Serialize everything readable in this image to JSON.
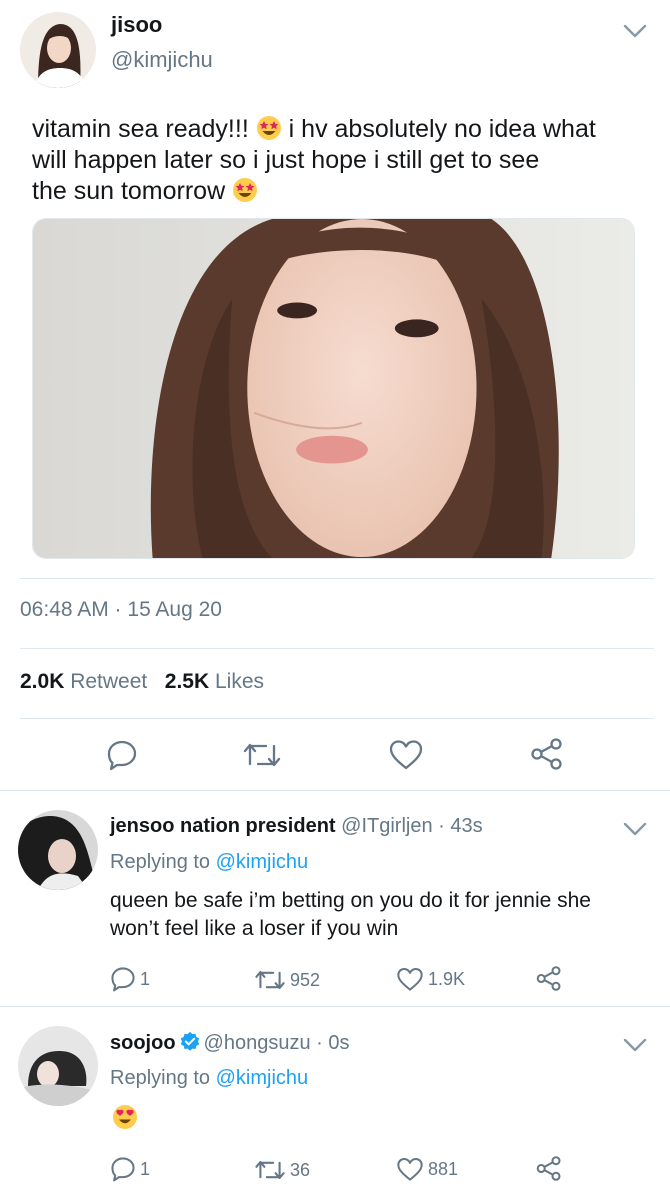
{
  "main_tweet": {
    "display_name": "jisoo",
    "handle": "@kimjichu",
    "text_line1": "vitamin sea ready!!!",
    "text_line1b": "i hv absolutely no idea what",
    "text_line2": "will happen later so i just hope i still get to see",
    "text_line3": "the sun tomorrow",
    "timestamp": "06:48 AM · 15 Aug 20",
    "retweet_count": "2.0K",
    "retweet_label": "Retweet",
    "likes_count": "2.5K",
    "likes_label": "Likes"
  },
  "replies": [
    {
      "display_name": "jensoo nation president",
      "handle": "@ITgirljen",
      "time": "· 43s",
      "replying_prefix": "Replying to",
      "replying_to": "@kimjichu",
      "text_line1": "queen be safe i’m betting on you do it for jennie she",
      "text_line2": "won’t feel like a loser if you win",
      "reply_count": "1",
      "retweet_count": "952",
      "like_count": "1.9K"
    },
    {
      "display_name": "soojoo",
      "handle": "@hongsuzu",
      "time": "· 0s",
      "replying_prefix": "Replying to",
      "replying_to": "@kimjichu",
      "reply_count": "1",
      "retweet_count": "36",
      "like_count": "881"
    }
  ],
  "colors": {
    "text": "#14171a",
    "secondary": "#657786",
    "link": "#1da1f2",
    "icon": "#657786",
    "divider": "#e1e8ed"
  },
  "icons": [
    "reply-icon",
    "retweet-icon",
    "heart-icon",
    "share-icon",
    "chevron-down-icon",
    "verified-badge-icon",
    "star-struck-emoji",
    "heart-eyes-emoji"
  ]
}
